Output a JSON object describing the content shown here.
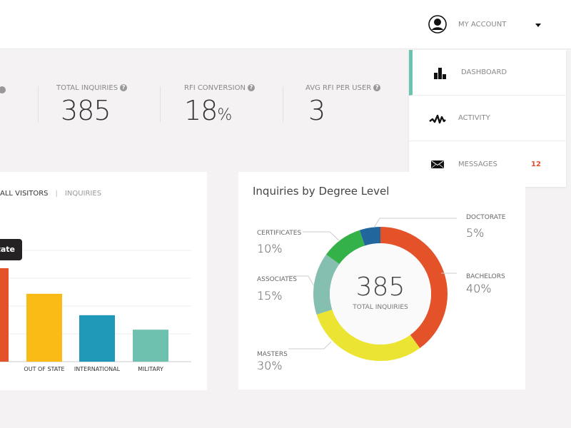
{
  "header": {
    "account_label": "MY ACCOUNT",
    "avatar_icon": "user-avatar-icon",
    "caret_icon": "caret-down-icon"
  },
  "menu": {
    "items": [
      {
        "label": "DASHBOARD",
        "icon": "bar-chart-icon",
        "active": true
      },
      {
        "label": "ACTIVITY",
        "icon": "activity-wave-icon"
      },
      {
        "label": "MESSAGES",
        "icon": "envelope-icon",
        "badge": "12"
      }
    ],
    "accent": "#6cc3b0",
    "badge_color": "#e4522a"
  },
  "stats": [
    {
      "label": "TOTAL INQUIRIES",
      "value": "385",
      "help": "?"
    },
    {
      "label": "RFI CONVERSION",
      "value": "18",
      "unit": "%",
      "help": "?"
    },
    {
      "label": "AVG RFI PER USER",
      "value": "3",
      "help": "?"
    }
  ],
  "visitors_card": {
    "tabs": {
      "active": "ALL VISITORS",
      "divider": "|",
      "other": "INQUIRIES"
    },
    "tooltip": "tate"
  },
  "degree_card": {
    "title": "Inquiries by Degree Level",
    "center_value": "385",
    "center_label": "TOTAL INQUIRIES"
  },
  "chart_data": [
    {
      "type": "bar",
      "categories": [
        "E",
        "OUT OF STATE",
        "INTERNATIONAL",
        "MILITARY"
      ],
      "values": [
        3.36,
        2.44,
        1.67,
        1.15
      ],
      "ylim": [
        0,
        4
      ],
      "grid": true,
      "colors": [
        "#e4522a",
        "#fbbb17",
        "#2098b8",
        "#6dc1ae"
      ]
    },
    {
      "type": "pie",
      "donut": true,
      "labels": [
        "BACHELORS",
        "MASTERS",
        "ASSOCIATES",
        "CERTIFICATES",
        "DOCTORATE"
      ],
      "values": [
        40,
        30,
        15,
        10,
        5
      ],
      "value_labels": [
        "40%",
        "30%",
        "15%",
        "10%",
        "5%"
      ],
      "colors": [
        "#e4522a",
        "#ebe432",
        "#85bfb0",
        "#35b14a",
        "#21679e"
      ]
    }
  ]
}
